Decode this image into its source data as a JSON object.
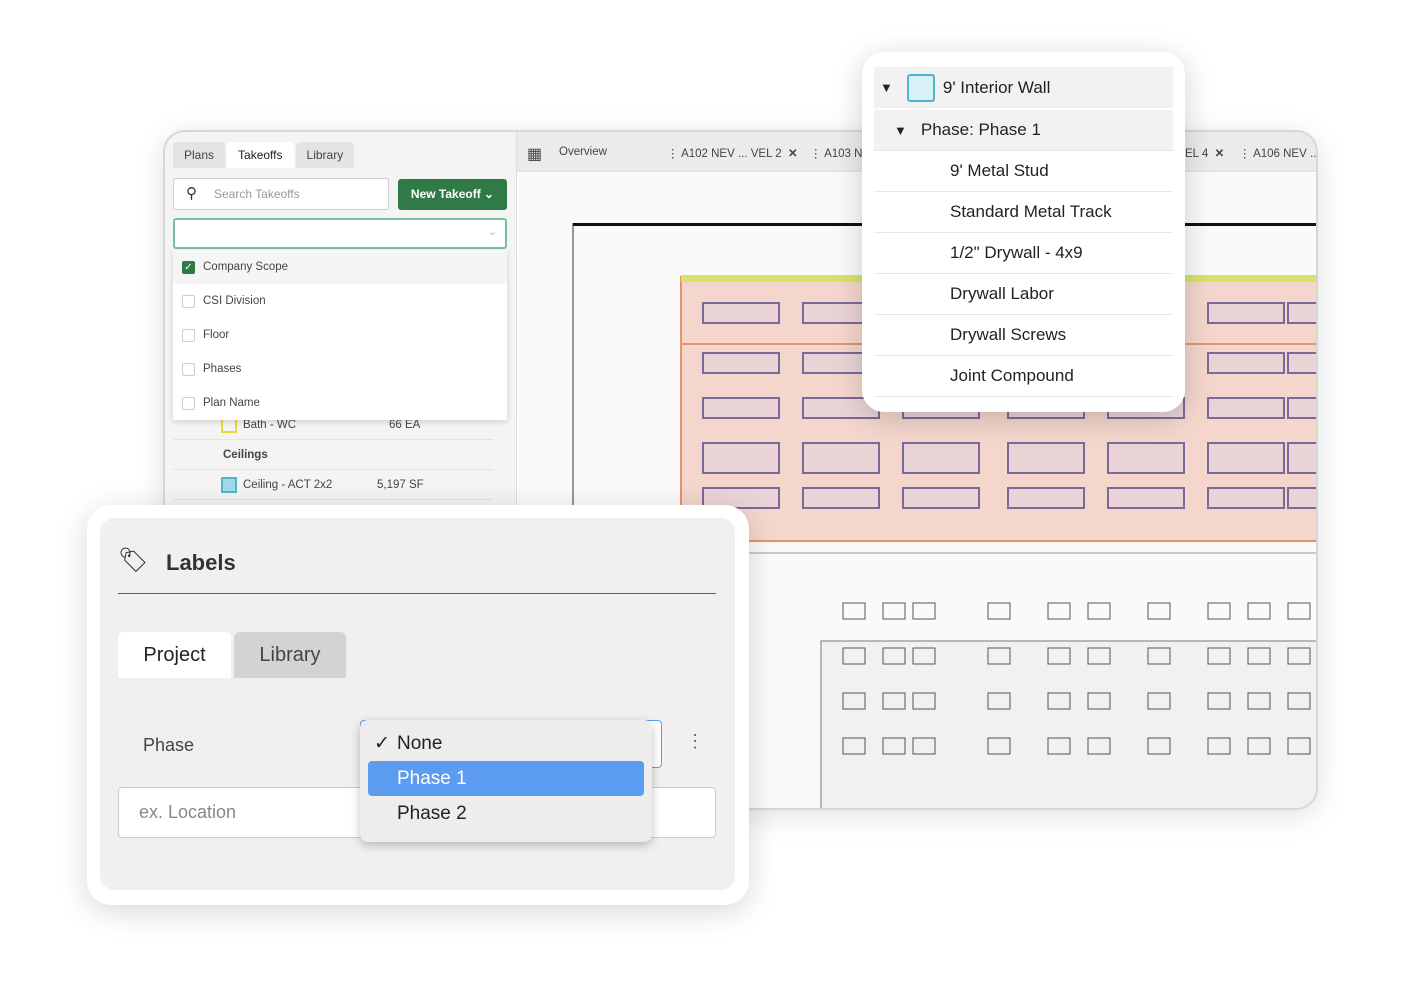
{
  "app": {
    "tabs": [
      "Plans",
      "Takeoffs",
      "Library"
    ],
    "active_tab": "Takeoffs",
    "search_placeholder": "Search Takeoffs",
    "new_takeoff": "New Takeoff"
  },
  "group_by_options": [
    {
      "label": "Company Scope",
      "checked": true
    },
    {
      "label": "CSI Division",
      "checked": false
    },
    {
      "label": "Floor",
      "checked": false
    },
    {
      "label": "Phases",
      "checked": false
    },
    {
      "label": "Plan Name",
      "checked": false
    }
  ],
  "takeoffs": [
    {
      "name": "Bath - WC",
      "qty": "66 EA",
      "color": "#e8d83a"
    },
    {
      "group": "Ceilings"
    },
    {
      "name": "Ceiling - ACT 2x2",
      "qty": "5,197 SF",
      "color": "#4fb7c9"
    }
  ],
  "plan_tabs": {
    "overview": "Overview",
    "tabs": [
      "A102 NEV ... VEL 2",
      "A103 N",
      "EL 4",
      "A106 NEV ..."
    ]
  },
  "assembly": {
    "title": "9' Interior Wall",
    "phase": "Phase: Phase 1",
    "items": [
      "9' Metal Stud",
      "Standard Metal Track",
      "1/2\" Drywall - 4x9",
      "Drywall Labor",
      "Drywall Screws",
      "Joint Compound"
    ]
  },
  "labels_panel": {
    "title": "Labels",
    "tabs": [
      "Project",
      "Library"
    ],
    "active_tab": "Project",
    "phase_label": "Phase",
    "location_placeholder": "ex. Location",
    "phase_options": [
      "None",
      "Phase 1",
      "Phase 2"
    ],
    "selected": "None",
    "highlighted": "Phase 1"
  },
  "colors": {
    "brand_green": "#2f7a47",
    "highlight_blue": "#5b9cf0"
  }
}
